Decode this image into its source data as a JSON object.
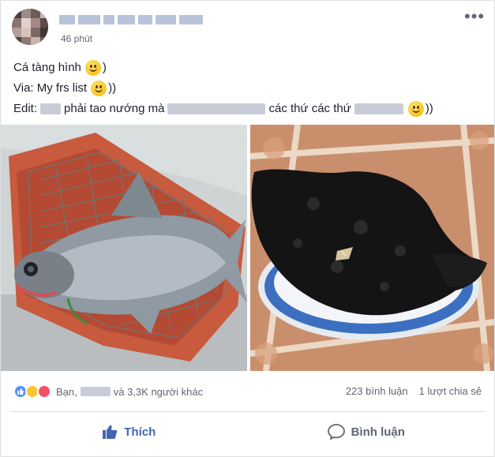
{
  "post": {
    "time": "46 phút",
    "lines": {
      "l1": "Cá tàng hình",
      "l1_end": ")",
      "l2": "Via: My frs list",
      "l2_end": "))",
      "l3_a": "Edit:",
      "l3_b": "phải tao nướng mà",
      "l3_c": "các thứ các thứ",
      "l3_end": "))"
    }
  },
  "reactions": {
    "prefix": "Bạn,",
    "suffix": "và 3,3K người khác"
  },
  "stats": {
    "comments": "223 bình luận",
    "shares": "1 lượt chia sẻ"
  },
  "actions": {
    "like": "Thích",
    "comment": "Bình luận"
  },
  "colors": {
    "accent": "#4267b2",
    "muted": "#606770"
  }
}
